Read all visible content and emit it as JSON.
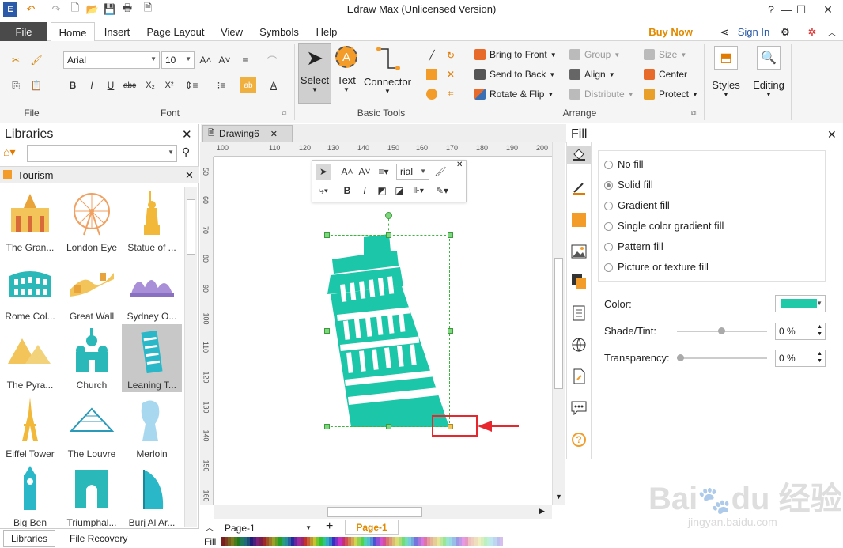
{
  "window": {
    "title": "Edraw Max (Unlicensed Version)"
  },
  "menu": {
    "file": "File",
    "tabs": [
      "Home",
      "Insert",
      "Page Layout",
      "View",
      "Symbols",
      "Help"
    ],
    "buy_now": "Buy Now",
    "sign_in": "Sign In"
  },
  "ribbon": {
    "groups": {
      "file": "File",
      "font": "Font",
      "basic_tools": "Basic Tools",
      "arrange": "Arrange"
    },
    "font_name": "Arial",
    "font_size": "10",
    "tools": {
      "select": "Select",
      "text": "Text",
      "connector": "Connector"
    },
    "arrange": {
      "bring_to_front": "Bring to Front",
      "send_to_back": "Send to Back",
      "rotate_flip": "Rotate & Flip",
      "group": "Group",
      "align": "Align",
      "distribute": "Distribute",
      "size": "Size",
      "center": "Center",
      "protect": "Protect"
    },
    "styles": "Styles",
    "editing": "Editing"
  },
  "libraries": {
    "title": "Libraries",
    "category": "Tourism",
    "items": [
      {
        "label": "The Gran..."
      },
      {
        "label": "London Eye"
      },
      {
        "label": "Statue of ..."
      },
      {
        "label": "Rome Col..."
      },
      {
        "label": "Great Wall"
      },
      {
        "label": "Sydney O..."
      },
      {
        "label": "The Pyra..."
      },
      {
        "label": "Church"
      },
      {
        "label": "Leaning T..."
      },
      {
        "label": "Eiffel Tower"
      },
      {
        "label": "The Louvre"
      },
      {
        "label": "Merloin"
      },
      {
        "label": "Big Ben"
      },
      {
        "label": "Triumphal..."
      },
      {
        "label": "Burj Al Ar..."
      }
    ],
    "tabs": {
      "libraries": "Libraries",
      "file_recovery": "File Recovery"
    }
  },
  "document": {
    "tab": "Drawing6",
    "ruler_h": [
      "100",
      "110",
      "120",
      "130",
      "140",
      "150",
      "160",
      "170",
      "180",
      "190",
      "200"
    ],
    "ruler_v": [
      "50",
      "60",
      "70",
      "80",
      "90",
      "100",
      "110",
      "120",
      "130",
      "140",
      "150",
      "160"
    ],
    "floating_toolbar": {
      "font": "rial"
    },
    "page_tab": "Page-1",
    "page_tab_active": "Page-1",
    "fill_label": "Fill"
  },
  "fill_panel": {
    "title": "Fill",
    "options": [
      "No fill",
      "Solid fill",
      "Gradient fill",
      "Single color gradient fill",
      "Pattern fill",
      "Picture or texture fill"
    ],
    "selected": "Solid fill",
    "color_label": "Color:",
    "color_value": "#20c9a8",
    "shade_label": "Shade/Tint:",
    "shade_value": "0 %",
    "transparency_label": "Transparency:",
    "transparency_value": "0 %"
  },
  "colors": {
    "accent": "#20c9a8",
    "buy_now": "#e08a00",
    "annotation": "#e8262d"
  }
}
